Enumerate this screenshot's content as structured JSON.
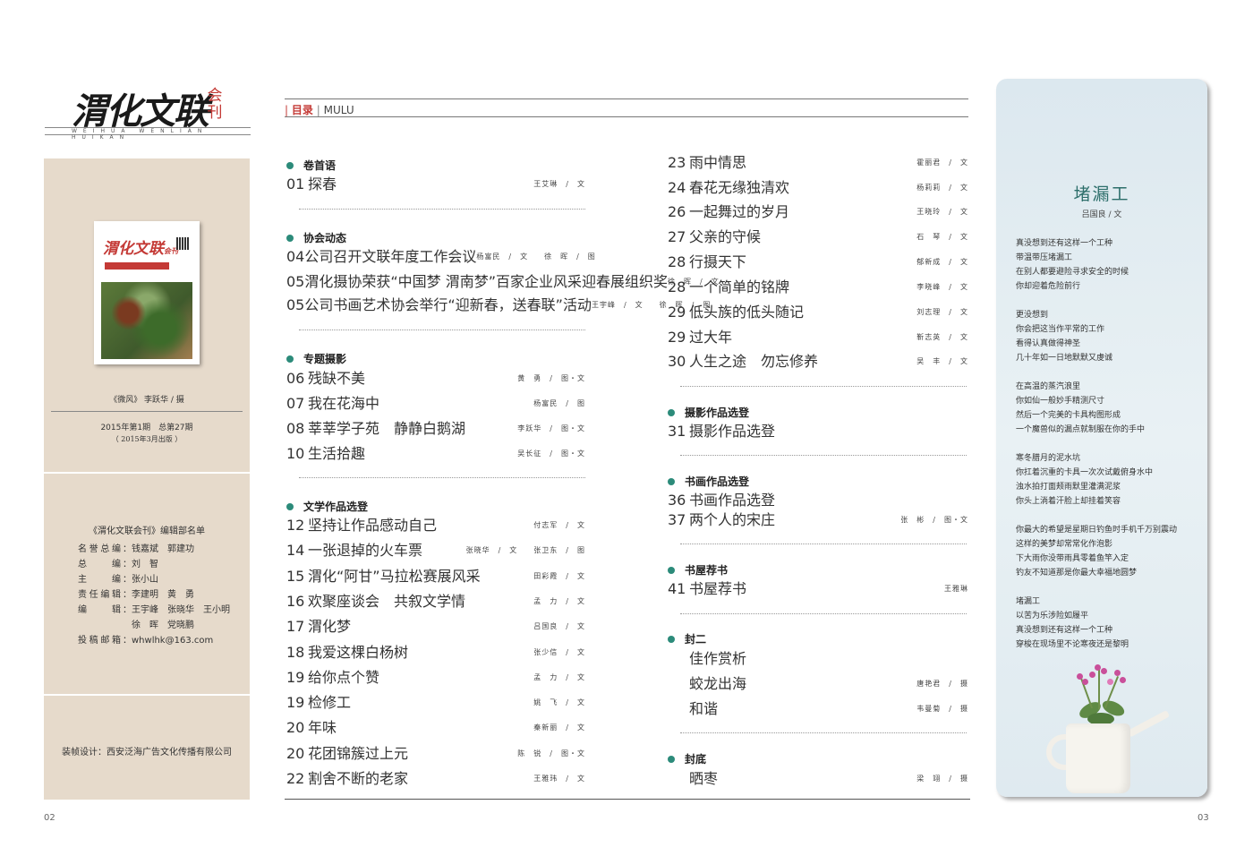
{
  "masthead": {
    "logo": "渭化文联",
    "logo_suffix": "会刊",
    "pinyin": "WEIHUA WENLIAN HUIKAN"
  },
  "cover": {
    "logo": "渭化文联",
    "suffix": "会刊"
  },
  "photo_caption": "《微风》 李跃华 / 摄",
  "issue": {
    "line1": "2015年第1期　总第27期",
    "line2": "（ 2015年3月出版 ）"
  },
  "staff": {
    "title": "《渭化文联会刊》编辑部名单",
    "rows": [
      {
        "label": "名誉总编",
        "value": "钱嘉斌　郭建功"
      },
      {
        "label": "总编",
        "value": "刘　智"
      },
      {
        "label": "主编",
        "value": "张小山"
      },
      {
        "label": "责任编辑",
        "value": "李建明　黄　勇"
      },
      {
        "label": "编辑",
        "value": "王宇峰　张晓华　王小明"
      },
      {
        "label": "",
        "value": "徐　晖　党晓鹏"
      },
      {
        "label": "投稿邮箱",
        "value": "whwlhk@163.com"
      }
    ]
  },
  "design_credit": "装帧设计：西安泛海广告文化传播有限公司",
  "header": {
    "mulu_cn": "目录",
    "mulu_en": "MULU"
  },
  "toc_left": {
    "s1": {
      "title": "卷首语",
      "rows": [
        {
          "pg": "01",
          "title": "探春",
          "author": "王艾琳　/　文"
        }
      ]
    },
    "s2": {
      "title": "协会动态",
      "rows": [
        {
          "pg": "04",
          "title": "公司召开文联年度工作会议",
          "author": "杨富民　/　文　　徐　晖　/　图"
        },
        {
          "pg": "05",
          "title": "渭化摄协荣获“中国梦 渭南梦”百家企业风采迎春展组织奖",
          "author": "徐　晖　/　文"
        },
        {
          "pg": "05",
          "title": "公司书画艺术协会举行“迎新春，送春联”活动",
          "author": "王宇峰　/　文　　徐　晖　/　图"
        }
      ]
    },
    "s3": {
      "title": "专题摄影",
      "rows": [
        {
          "pg": "06",
          "title": "残缺不美",
          "author": "黄　勇　/　图・文"
        },
        {
          "pg": "07",
          "title": "我在花海中",
          "author": "杨富民　/　图"
        },
        {
          "pg": "08",
          "title": "莘莘学子苑　静静白鹅湖",
          "author": "李跃华　/　图・文"
        },
        {
          "pg": "10",
          "title": "生活拾趣",
          "author": "吴长征　/　图・文"
        }
      ]
    },
    "s4": {
      "title": "文学作品选登",
      "rows": [
        {
          "pg": "12",
          "title": "坚持让作品感动自己",
          "author": "付志军　/　文"
        },
        {
          "pg": "14",
          "title": "一张退掉的火车票",
          "author": "张晓华　/　文　　张卫东　/　图"
        },
        {
          "pg": "15",
          "title": "渭化“阿甘”马拉松赛展风采",
          "author": "田彩霞　/　文"
        },
        {
          "pg": "16",
          "title": "欢聚座谈会　共叙文学情",
          "author": "孟　力　/　文"
        },
        {
          "pg": "17",
          "title": "渭化梦",
          "author": "吕国良　/　文"
        },
        {
          "pg": "18",
          "title": "我爱这棵白杨树",
          "author": "张少信　/　文"
        },
        {
          "pg": "19",
          "title": "给你点个赞",
          "author": "孟　力　/　文"
        },
        {
          "pg": "19",
          "title": "检修工",
          "author": "姚　飞　/　文"
        },
        {
          "pg": "20",
          "title": "年味",
          "author": "秦新丽　/　文"
        },
        {
          "pg": "20",
          "title": "花团锦簇过上元",
          "author": "陈　锐　/　图・文"
        },
        {
          "pg": "22",
          "title": "割舍不断的老家",
          "author": "王雅玮　/　文"
        }
      ]
    }
  },
  "toc_right": {
    "top_rows": [
      {
        "pg": "23",
        "title": "雨中情思",
        "author": "霍丽君　/　文"
      },
      {
        "pg": "24",
        "title": "春花无缘独清欢",
        "author": "杨莉莉　/　文"
      },
      {
        "pg": "26",
        "title": "一起舞过的岁月",
        "author": "王晓玲　/　文"
      },
      {
        "pg": "27",
        "title": "父亲的守候",
        "author": "石　琴　/　文"
      },
      {
        "pg": "28",
        "title": "行摄天下",
        "author": "郁新成　/　文"
      },
      {
        "pg": "28",
        "title": "一个简单的铭牌",
        "author": "李晓峰　/　文"
      },
      {
        "pg": "29",
        "title": "低头族的低头随记",
        "author": "刘志理　/　文"
      },
      {
        "pg": "29",
        "title": "过大年",
        "author": "靳志英　/　文"
      },
      {
        "pg": "30",
        "title": "人生之途　勿忘修养",
        "author": "吴　丰　/　文"
      }
    ],
    "s5": {
      "title": "摄影作品选登",
      "rows": [
        {
          "pg": "31",
          "title": "摄影作品选登",
          "author": ""
        }
      ]
    },
    "s6": {
      "title": "书画作品选登",
      "rows": [
        {
          "pg": "36",
          "title": "书画作品选登",
          "author": ""
        },
        {
          "pg": "37",
          "title": "两个人的宋庄",
          "author": "张　彬　/　图・文"
        }
      ]
    },
    "s7": {
      "title": "书屋荐书",
      "rows": [
        {
          "pg": "41",
          "title": "书屋荐书",
          "author": "王雅琳"
        }
      ]
    },
    "s8": {
      "title": "封二",
      "rows": [
        {
          "pg": "",
          "title": "佳作赏析",
          "author": ""
        },
        {
          "pg": "",
          "title": "蛟龙出海",
          "author": "唐艳君　/　摄"
        },
        {
          "pg": "",
          "title": "和谐",
          "author": "韦曼菊　/　摄"
        }
      ]
    },
    "s9": {
      "title": "封底",
      "rows": [
        {
          "pg": "",
          "title": "晒枣",
          "author": "梁　翊　/　摄"
        }
      ]
    }
  },
  "poem": {
    "title": "堵漏工",
    "author": "吕国良 / 文",
    "stanzas": [
      [
        "真没想到还有这样一个工种",
        "带温带压堵漏工",
        "在别人都要避险寻求安全的时候",
        "你却迎着危险前行"
      ],
      [
        "更没想到",
        "你会把这当作平常的工作",
        "看得认真做得神圣",
        "几十年如一日地默默又虔诚"
      ],
      [
        "在高温的蒸汽浪里",
        "你如仙一般妙手精测尺寸",
        "然后一个完美的卡具构图形成",
        "一个魔兽似的漏点就制服在你的手中"
      ],
      [
        "寒冬腊月的泥水坑",
        "你扛着沉重的卡具一次次试戴俯身水中",
        "浊水拍打面颊雨默里灌满泥浆",
        "你头上淌着汗脸上却挂着笑容"
      ],
      [
        "你最大的希望是星期日钓鱼时手机千万别震动",
        "这样的美梦却常常化作泡影",
        "下大雨你没带雨具零着鱼竿入定",
        "钓友不知道那是你最大幸福地圆梦"
      ],
      [
        "堵漏工",
        "以苦为乐涉险如履平",
        "真没想到还有这样一个工种",
        "穿梭在现场里不论寒夜还是黎明"
      ]
    ]
  },
  "page_numbers": {
    "left": "02",
    "right": "03"
  },
  "colors": {
    "accent_teal": "#2c8b7a",
    "accent_red": "#c43a36",
    "panel_beige": "#e6dacb",
    "poem_panel": "#dce8ef"
  }
}
